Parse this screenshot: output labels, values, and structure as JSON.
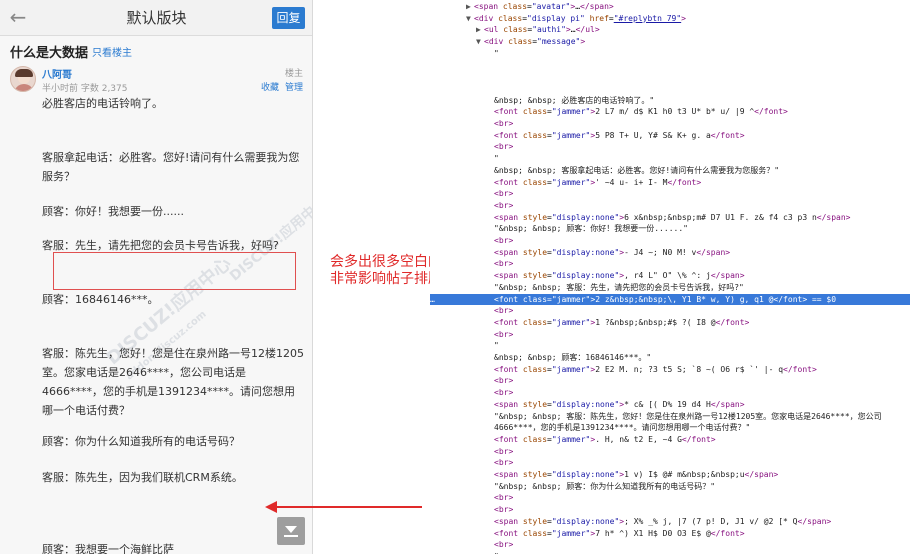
{
  "mobile": {
    "header": {
      "title": "默认版块",
      "reply_label": "回复"
    },
    "thread": {
      "title": "什么是大数据",
      "op_only_label": "只看楼主"
    },
    "post": {
      "author": "八阿哥",
      "meta": "半小时前 字数 2,375",
      "floor": "楼主",
      "fav": "收藏",
      "manage": "管理",
      "paragraphs": [
        "必胜客店的电话铃响了。",
        "客服拿起电话：必胜客。您好!请问有什么需要我为您服务？",
        "顾客：你好！我想要一份......",
        "客服：先生，请先把您的会员卡号告诉我，好吗?",
        "顾客：16846146***。",
        "客服：陈先生，您好！您是住在泉州路一号12楼1205室。您家电话是2646****，您公司电话是4666****，您的手机是1391234****。请问您想用哪一个电话付费？",
        "顾客：你为什么知道我所有的电话号码？",
        "客服：陈先生，因为我们联机CRM系统。",
        "顾客：我想要一个海鲜比萨"
      ]
    },
    "watermark": "DISCUZ!应用中心",
    "watermark2": "addon.discuz.com"
  },
  "annotation": {
    "line1": "会多出很多空白的位置",
    "line2": "非常影响帖子排版"
  },
  "devtools": {
    "lines": [
      {
        "i": 0,
        "tri": "▶",
        "html": "<span class=\"tag\">&lt;span</span> <span class=\"attr\">class</span>=<span class=\"val\">\"avatar\"</span><span class=\"tag\">&gt;</span>…<span class=\"tag\">&lt;/span&gt;</span>"
      },
      {
        "i": 0,
        "tri": "▼",
        "html": "<span class=\"tag\">&lt;div</span> <span class=\"attr\">class</span>=<span class=\"val\">\"display pi\"</span> <span class=\"attr\">href</span>=<span class=\"lnk\">\"#replybtn_79\"</span><span class=\"tag\">&gt;</span>"
      },
      {
        "i": 1,
        "tri": "▶",
        "html": "<span class=\"tag\">&lt;ul</span> <span class=\"attr\">class</span>=<span class=\"val\">\"authi\"</span><span class=\"tag\">&gt;</span>…<span class=\"tag\">&lt;/ul&gt;</span>"
      },
      {
        "i": 1,
        "tri": "▼",
        "html": "<span class=\"tag\">&lt;div</span> <span class=\"attr\">class</span>=<span class=\"val\">\"message\"</span><span class=\"tag\">&gt;</span>"
      },
      {
        "i": 2,
        "tri": "",
        "html": "<span class=\"txt\">\"</span>"
      },
      {
        "i": 2,
        "tri": "",
        "html": ""
      },
      {
        "i": 2,
        "tri": "",
        "html": ""
      },
      {
        "i": 2,
        "tri": "",
        "html": ""
      },
      {
        "i": 2,
        "tri": "",
        "html": "<span class=\"txt\">&amp;nbsp; &amp;nbsp; 必胜客店的电话铃响了。\"</span>"
      },
      {
        "i": 2,
        "tri": "",
        "html": "<span class=\"tag\">&lt;font</span> <span class=\"attr\">class</span>=<span class=\"val\">\"jammer\"</span><span class=\"tag\">&gt;</span><span class=\"txt\">2 L7 m/ d$ K1 h0 t3 U* b* u/ |9 ^</span><span class=\"tag\">&lt;/font&gt;</span>"
      },
      {
        "i": 2,
        "tri": "",
        "html": "<span class=\"tag\">&lt;br&gt;</span>"
      },
      {
        "i": 2,
        "tri": "",
        "html": "<span class=\"tag\">&lt;font</span> <span class=\"attr\">class</span>=<span class=\"val\">\"jammer\"</span><span class=\"tag\">&gt;</span><span class=\"txt\">5 P8 T+ U, Y# S&amp; K+ g. a</span><span class=\"tag\">&lt;/font&gt;</span>"
      },
      {
        "i": 2,
        "tri": "",
        "html": "<span class=\"tag\">&lt;br&gt;</span>"
      },
      {
        "i": 2,
        "tri": "",
        "html": "<span class=\"txt\">\"</span>"
      },
      {
        "i": 2,
        "tri": "",
        "html": "<span class=\"txt\">&amp;nbsp; &amp;nbsp; 客服拿起电话：必胜客。您好!请问有什么需要我为您服务？\"</span>"
      },
      {
        "i": 2,
        "tri": "",
        "html": "<span class=\"tag\">&lt;font</span> <span class=\"attr\">class</span>=<span class=\"val\">\"jammer\"</span><span class=\"tag\">&gt;</span><span class=\"txt\">' ~4 u- i+ I- M</span><span class=\"tag\">&lt;/font&gt;</span>"
      },
      {
        "i": 2,
        "tri": "",
        "html": "<span class=\"tag\">&lt;br&gt;</span>"
      },
      {
        "i": 2,
        "tri": "",
        "html": "<span class=\"tag\">&lt;br&gt;</span>"
      },
      {
        "i": 2,
        "tri": "",
        "html": "<span class=\"tag\">&lt;span</span> <span class=\"attr\">style</span>=<span class=\"val\">\"display:none\"</span><span class=\"tag\">&gt;</span><span class=\"txt\">6 x&amp;nbsp;&amp;nbsp;m# D7 U1 F. z&amp; f4 c3 p3 n</span><span class=\"tag\">&lt;/span&gt;</span>"
      },
      {
        "i": 2,
        "tri": "",
        "html": "<span class=\"txt\">\"&amp;nbsp; &amp;nbsp; 顾客：你好！我想要一份......\"</span>"
      },
      {
        "i": 2,
        "tri": "",
        "html": "<span class=\"tag\">&lt;br&gt;</span>"
      },
      {
        "i": 2,
        "tri": "",
        "html": "<span class=\"tag\">&lt;span</span> <span class=\"attr\">style</span>=<span class=\"val\">\"display:none\"</span><span class=\"tag\">&gt;</span><span class=\"txt\">- J4 ~; N0 M! v</span><span class=\"tag\">&lt;/span&gt;</span>"
      },
      {
        "i": 2,
        "tri": "",
        "html": "<span class=\"tag\">&lt;br&gt;</span>"
      },
      {
        "i": 2,
        "tri": "",
        "html": "<span class=\"tag\">&lt;span</span> <span class=\"attr\">style</span>=<span class=\"val\">\"display:none\"</span><span class=\"tag\">&gt;</span><span class=\"txt\">, r4 L\" O\" \\% ^: j</span><span class=\"tag\">&lt;/span&gt;</span>"
      },
      {
        "i": 2,
        "tri": "",
        "html": "<span class=\"txt\">\"&amp;nbsp; &amp;nbsp; 客服：先生，请先把您的会员卡号告诉我，好吗?\"</span>"
      },
      {
        "i": 2,
        "tri": "",
        "html": "<span class=\"tag\">&lt;font</span> <span class=\"attr\">class</span>=<span class=\"val\">\"jammer\"</span><span class=\"tag\">&gt;</span><span class=\"txt\">2 z&amp;nbsp;&amp;nbsp;\\, Y1 B* w, Y) g, q1 @</span><span class=\"tag\">&lt;/font&gt;</span><span class=\"txt\"> == $0</span>",
        "sel": true
      },
      {
        "i": 2,
        "tri": "",
        "html": "<span class=\"tag\">&lt;br&gt;</span>"
      },
      {
        "i": 2,
        "tri": "",
        "html": "<span class=\"tag\">&lt;font</span> <span class=\"attr\">class</span>=<span class=\"val\">\"jammer\"</span><span class=\"tag\">&gt;</span><span class=\"txt\">1 ?&amp;nbsp;&amp;nbsp;#$ ?( I8 @</span><span class=\"tag\">&lt;/font&gt;</span>"
      },
      {
        "i": 2,
        "tri": "",
        "html": "<span class=\"tag\">&lt;br&gt;</span>"
      },
      {
        "i": 2,
        "tri": "",
        "html": "<span class=\"txt\">\"</span>"
      },
      {
        "i": 2,
        "tri": "",
        "html": "<span class=\"txt\">&amp;nbsp; &amp;nbsp; 顾客：16846146***。\"</span>"
      },
      {
        "i": 2,
        "tri": "",
        "html": "<span class=\"tag\">&lt;font</span> <span class=\"attr\">class</span>=<span class=\"val\">\"jammer\"</span><span class=\"tag\">&gt;</span><span class=\"txt\">2 E2 M. n; ?3 t5 S; `8 ~( O6 r$ `' |- q</span><span class=\"tag\">&lt;/font&gt;</span>"
      },
      {
        "i": 2,
        "tri": "",
        "html": "<span class=\"tag\">&lt;br&gt;</span>"
      },
      {
        "i": 2,
        "tri": "",
        "html": "<span class=\"tag\">&lt;br&gt;</span>"
      },
      {
        "i": 2,
        "tri": "",
        "html": "<span class=\"tag\">&lt;span</span> <span class=\"attr\">style</span>=<span class=\"val\">\"display:none\"</span><span class=\"tag\">&gt;</span><span class=\"txt\">* c&amp; [( D% 19 d4 H</span><span class=\"tag\">&lt;/span&gt;</span>"
      },
      {
        "i": 2,
        "tri": "",
        "html": "<span class=\"txt\">\"&amp;nbsp; &amp;nbsp; 客服：陈先生，您好！您是住在泉州路一号12楼1205室。您家电话是2646****，您公司</span>"
      },
      {
        "i": 2,
        "tri": "",
        "html": "<span class=\"txt\">4666****，您的手机是1391234****。请问您想用哪一个电话付费？\"</span>"
      },
      {
        "i": 2,
        "tri": "",
        "html": "<span class=\"tag\">&lt;font</span> <span class=\"attr\">class</span>=<span class=\"val\">\"jammer\"</span><span class=\"tag\">&gt;</span><span class=\"txt\">. H, n&amp; t2 E, ~4 G</span><span class=\"tag\">&lt;/font&gt;</span>"
      },
      {
        "i": 2,
        "tri": "",
        "html": "<span class=\"tag\">&lt;br&gt;</span>"
      },
      {
        "i": 2,
        "tri": "",
        "html": "<span class=\"tag\">&lt;br&gt;</span>"
      },
      {
        "i": 2,
        "tri": "",
        "html": "<span class=\"tag\">&lt;span</span> <span class=\"attr\">style</span>=<span class=\"val\">\"display:none\"</span><span class=\"tag\">&gt;</span><span class=\"txt\">1 v) I$ @# m&amp;nbsp;&amp;nbsp;u</span><span class=\"tag\">&lt;/span&gt;</span>"
      },
      {
        "i": 2,
        "tri": "",
        "html": "<span class=\"txt\">\"&amp;nbsp; &amp;nbsp; 顾客：你为什么知道我所有的电话号码？\"</span>"
      },
      {
        "i": 2,
        "tri": "",
        "html": "<span class=\"tag\">&lt;br&gt;</span>"
      },
      {
        "i": 2,
        "tri": "",
        "html": "<span class=\"tag\">&lt;br&gt;</span>"
      },
      {
        "i": 2,
        "tri": "",
        "html": "<span class=\"tag\">&lt;span</span> <span class=\"attr\">style</span>=<span class=\"val\">\"display:none\"</span><span class=\"tag\">&gt;</span><span class=\"txt\">; X% _% j, |7 (7 p! D, J1 v/ @2 [* Q</span><span class=\"tag\">&lt;/span&gt;</span>"
      },
      {
        "i": 2,
        "tri": "",
        "html": "<span class=\"tag\">&lt;font</span> <span class=\"attr\">class</span>=<span class=\"val\">\"jammer\"</span><span class=\"tag\">&gt;</span><span class=\"txt\">7 h* ^) X1 H$ D0 O3 E$ @</span><span class=\"tag\">&lt;/font&gt;</span>"
      },
      {
        "i": 2,
        "tri": "",
        "html": "<span class=\"tag\">&lt;br&gt;</span>"
      },
      {
        "i": 2,
        "tri": "",
        "html": "<span class=\"txt\">\"</span>"
      }
    ]
  }
}
